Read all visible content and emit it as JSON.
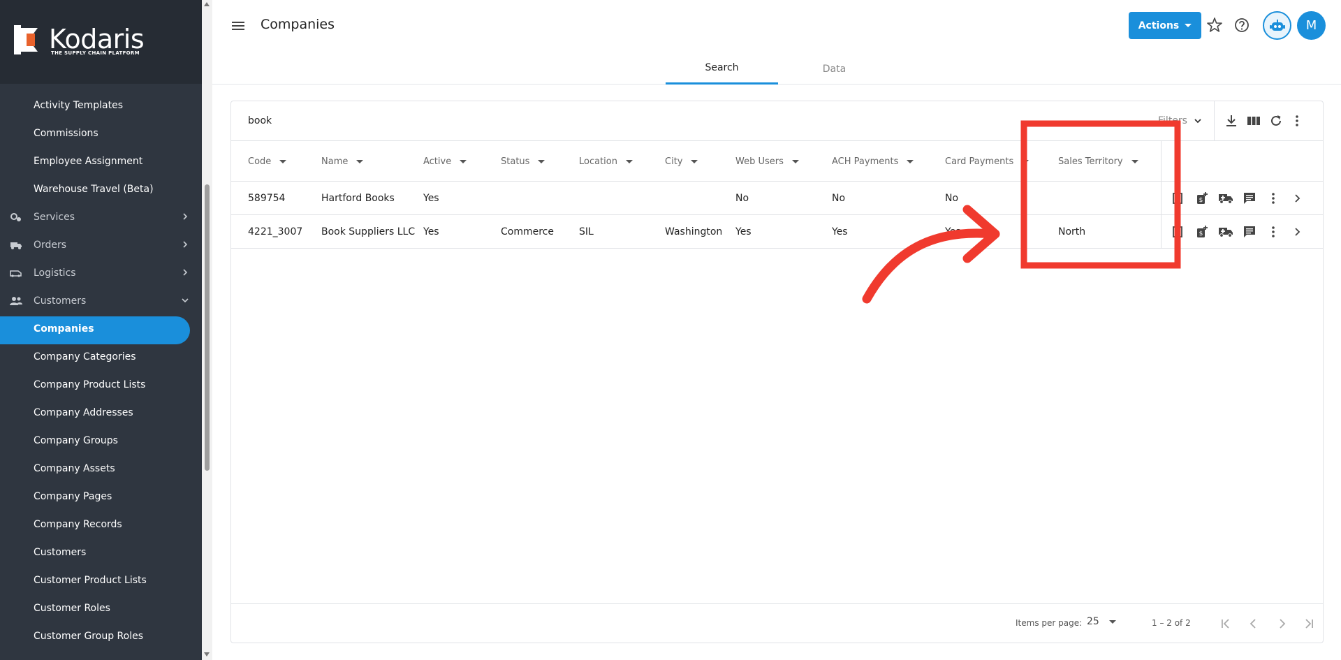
{
  "app": {
    "logo_text": "Kodaris",
    "logo_tagline": "THE SUPPLY CHAIN PLATFORM",
    "accent_color": "#1a8fdb",
    "sidebar_bg": "#2f3640"
  },
  "sidebar": {
    "items": [
      {
        "label": "Activity Templates",
        "type": "sub"
      },
      {
        "label": "Commissions",
        "type": "sub"
      },
      {
        "label": "Employee Assignment",
        "type": "sub"
      },
      {
        "label": "Warehouse Travel (Beta)",
        "type": "sub"
      },
      {
        "label": "Services",
        "type": "group",
        "icon": "gears-icon"
      },
      {
        "label": "Orders",
        "type": "group",
        "icon": "truck-icon"
      },
      {
        "label": "Logistics",
        "type": "group",
        "icon": "van-icon"
      },
      {
        "label": "Customers",
        "type": "group",
        "icon": "people-icon",
        "expanded": true
      },
      {
        "label": "Companies",
        "type": "sub",
        "active": true
      },
      {
        "label": "Company Categories",
        "type": "sub"
      },
      {
        "label": "Company Product Lists",
        "type": "sub"
      },
      {
        "label": "Company Addresses",
        "type": "sub"
      },
      {
        "label": "Company Groups",
        "type": "sub"
      },
      {
        "label": "Company Assets",
        "type": "sub"
      },
      {
        "label": "Company Pages",
        "type": "sub"
      },
      {
        "label": "Company Records",
        "type": "sub"
      },
      {
        "label": "Customers",
        "type": "sub"
      },
      {
        "label": "Customer Product Lists",
        "type": "sub"
      },
      {
        "label": "Customer Roles",
        "type": "sub"
      },
      {
        "label": "Customer Group Roles",
        "type": "sub"
      }
    ]
  },
  "header": {
    "title": "Companies",
    "actions_label": "Actions",
    "avatar_initial": "M"
  },
  "tabs": [
    {
      "label": "Search",
      "active": true
    },
    {
      "label": "Data",
      "active": false
    }
  ],
  "toolbar": {
    "search_value": "book",
    "filters_label": "Filters"
  },
  "table": {
    "columns": [
      "Code",
      "Name",
      "Active",
      "Status",
      "Location",
      "City",
      "Web Users",
      "ACH Payments",
      "Card Payments",
      "Sales Territory"
    ],
    "rows": [
      {
        "code": "589754",
        "name": "Hartford Books",
        "active": "Yes",
        "status": "",
        "location": "",
        "city": "",
        "web_users": "No",
        "ach": "No",
        "card": "No",
        "territory": ""
      },
      {
        "code": "4221_3007",
        "name": "Book Suppliers LLC",
        "active": "Yes",
        "status": "Commerce",
        "location": "SIL",
        "city": "Washington",
        "web_users": "Yes",
        "ach": "Yes",
        "card": "Yes",
        "territory": "North"
      }
    ]
  },
  "paginator": {
    "items_per_page_label": "Items per page:",
    "page_size": "25",
    "range_label": "1 – 2 of 2"
  },
  "annotation": {
    "highlight_color": "#f03a2e"
  }
}
